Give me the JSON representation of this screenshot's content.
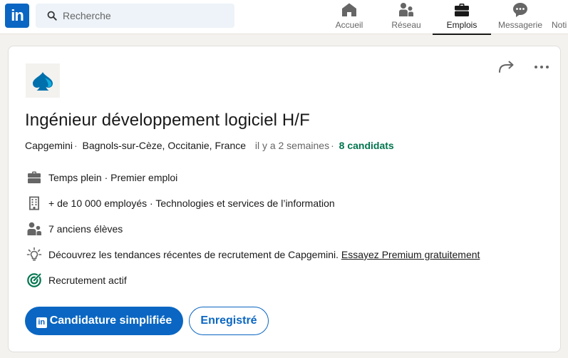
{
  "nav": {
    "logo_text": "in",
    "search_placeholder": "Recherche",
    "items": [
      {
        "label": "Accueil",
        "icon": "home-icon"
      },
      {
        "label": "Réseau",
        "icon": "people-icon"
      },
      {
        "label": "Emplois",
        "icon": "briefcase-icon",
        "active": true
      },
      {
        "label": "Messagerie",
        "icon": "messaging-icon"
      },
      {
        "label": "Noti",
        "icon": "bell-icon"
      }
    ]
  },
  "job": {
    "title": "Ingénieur développement logiciel H/F",
    "company": "Capgemini",
    "location": "Bagnols-sur-Cèze, Occitanie, France",
    "posted": "il y a 2 semaines",
    "applicants": "8 candidats",
    "insights": [
      {
        "icon": "briefcase-icon",
        "text": "Temps plein · Premier emploi"
      },
      {
        "icon": "building-icon",
        "text": "+ de 10 000 employés · Technologies et services de l’information"
      },
      {
        "icon": "people-icon",
        "text": "7 anciens élèves"
      },
      {
        "icon": "lightbulb-icon",
        "text": "Découvrez les tendances récentes de recrutement de Capgemini.",
        "link": "Essayez Premium gratuitement"
      },
      {
        "icon": "target-icon",
        "text": "Recrutement actif"
      }
    ],
    "apply_badge": "in",
    "apply_label": "Candidature simplifiée",
    "save_label": "Enregistré"
  },
  "colors": {
    "brand": "#0a66c2",
    "applicants": "#01754f",
    "active_recruiting": "#01754f",
    "background": "#f4f2ee"
  }
}
